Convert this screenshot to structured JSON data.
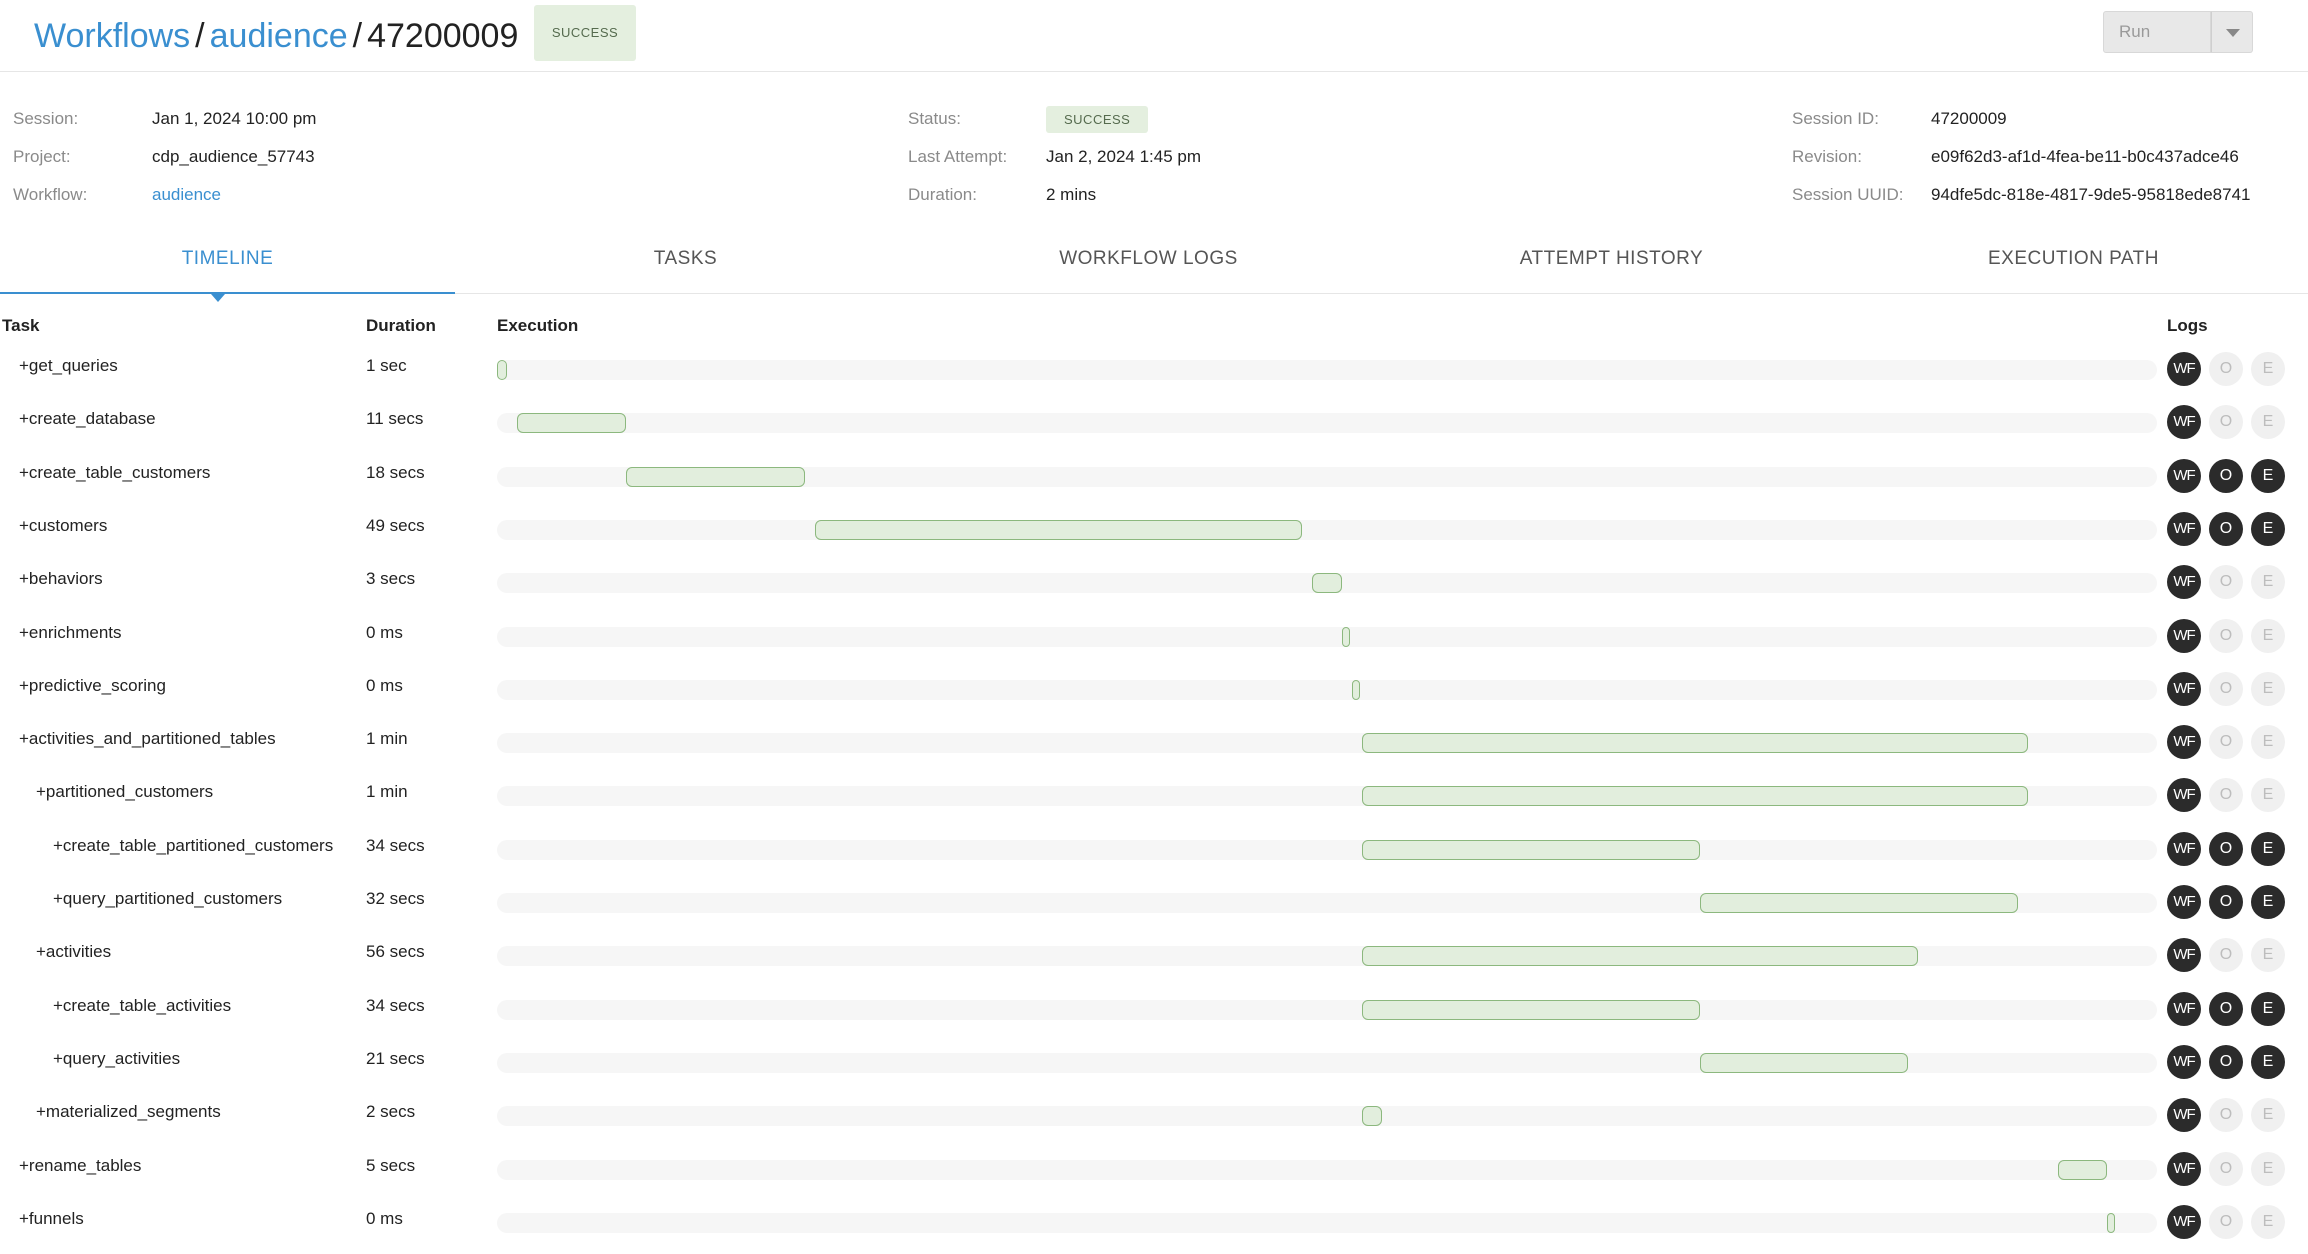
{
  "header": {
    "breadcrumb": [
      {
        "label": "Workflows"
      },
      {
        "label": "audience"
      },
      {
        "label": "47200009"
      }
    ],
    "status_badge": "SUCCESS",
    "run_label": "Run"
  },
  "info": {
    "left": [
      {
        "label": "Session:",
        "value": "Jan 1, 2024 10:00 pm"
      },
      {
        "label": "Project:",
        "value": "cdp_audience_57743"
      },
      {
        "label": "Workflow:",
        "value": "audience"
      }
    ],
    "middle": [
      {
        "label": "Status:",
        "value": "SUCCESS"
      },
      {
        "label": "Last Attempt:",
        "value": "Jan 2, 2024 1:45 pm"
      },
      {
        "label": "Duration:",
        "value": "2 mins"
      }
    ],
    "right": [
      {
        "label": "Session ID:",
        "value": "47200009"
      },
      {
        "label": "Revision:",
        "value": "e09f62d3-af1d-4fea-be11-b0c437adce46"
      },
      {
        "label": "Session UUID:",
        "value": "94dfe5dc-818e-4817-9de5-95818ede8741"
      }
    ]
  },
  "tabs": [
    {
      "label": "TIMELINE",
      "active": true
    },
    {
      "label": "TASKS",
      "active": false
    },
    {
      "label": "WORKFLOW LOGS",
      "active": false
    },
    {
      "label": "ATTEMPT HISTORY",
      "active": false
    },
    {
      "label": "EXECUTION PATH",
      "active": false
    }
  ],
  "table": {
    "headers": {
      "task": "Task",
      "duration": "Duration",
      "execution": "Execution",
      "logs": "Logs"
    },
    "log_labels": {
      "wf": "WF",
      "o": "O",
      "e": "E"
    },
    "timeline_total_secs": 167,
    "rows": [
      {
        "name": "+get_queries",
        "level": 0,
        "duration": "1 sec",
        "start": 0,
        "secs": 1,
        "o": false,
        "e": false
      },
      {
        "name": "+create_database",
        "level": 0,
        "duration": "11 secs",
        "start": 2,
        "secs": 11,
        "o": false,
        "e": false
      },
      {
        "name": "+create_table_customers",
        "level": 0,
        "duration": "18 secs",
        "start": 13,
        "secs": 18,
        "o": true,
        "e": true
      },
      {
        "name": "+customers",
        "level": 0,
        "duration": "49 secs",
        "start": 32,
        "secs": 49,
        "o": true,
        "e": true
      },
      {
        "name": "+behaviors",
        "level": 0,
        "duration": "3 secs",
        "start": 82,
        "secs": 3,
        "o": false,
        "e": false
      },
      {
        "name": "+enrichments",
        "level": 0,
        "duration": "0 ms",
        "start": 85,
        "secs": 0,
        "o": false,
        "e": false
      },
      {
        "name": "+predictive_scoring",
        "level": 0,
        "duration": "0 ms",
        "start": 86,
        "secs": 0,
        "o": false,
        "e": false
      },
      {
        "name": "+activities_and_partitioned_tables",
        "level": 0,
        "duration": "1 min",
        "start": 87,
        "secs": 67,
        "o": false,
        "e": false
      },
      {
        "name": "+partitioned_customers",
        "level": 1,
        "duration": "1 min",
        "start": 87,
        "secs": 67,
        "o": false,
        "e": false
      },
      {
        "name": "+create_table_partitioned_customers",
        "level": 2,
        "duration": "34 secs",
        "start": 87,
        "secs": 34,
        "o": true,
        "e": true
      },
      {
        "name": "+query_partitioned_customers",
        "level": 2,
        "duration": "32 secs",
        "start": 121,
        "secs": 32,
        "o": true,
        "e": true
      },
      {
        "name": "+activities",
        "level": 1,
        "duration": "56 secs",
        "start": 87,
        "secs": 56,
        "o": false,
        "e": false
      },
      {
        "name": "+create_table_activities",
        "level": 2,
        "duration": "34 secs",
        "start": 87,
        "secs": 34,
        "o": true,
        "e": true
      },
      {
        "name": "+query_activities",
        "level": 2,
        "duration": "21 secs",
        "start": 121,
        "secs": 21,
        "o": true,
        "e": true
      },
      {
        "name": "+materialized_segments",
        "level": 1,
        "duration": "2 secs",
        "start": 87,
        "secs": 2,
        "o": false,
        "e": false
      },
      {
        "name": "+rename_tables",
        "level": 0,
        "duration": "5 secs",
        "start": 157,
        "secs": 5,
        "o": false,
        "e": false
      },
      {
        "name": "+funnels",
        "level": 0,
        "duration": "0 ms",
        "start": 162,
        "secs": 0,
        "o": false,
        "e": false
      }
    ]
  }
}
